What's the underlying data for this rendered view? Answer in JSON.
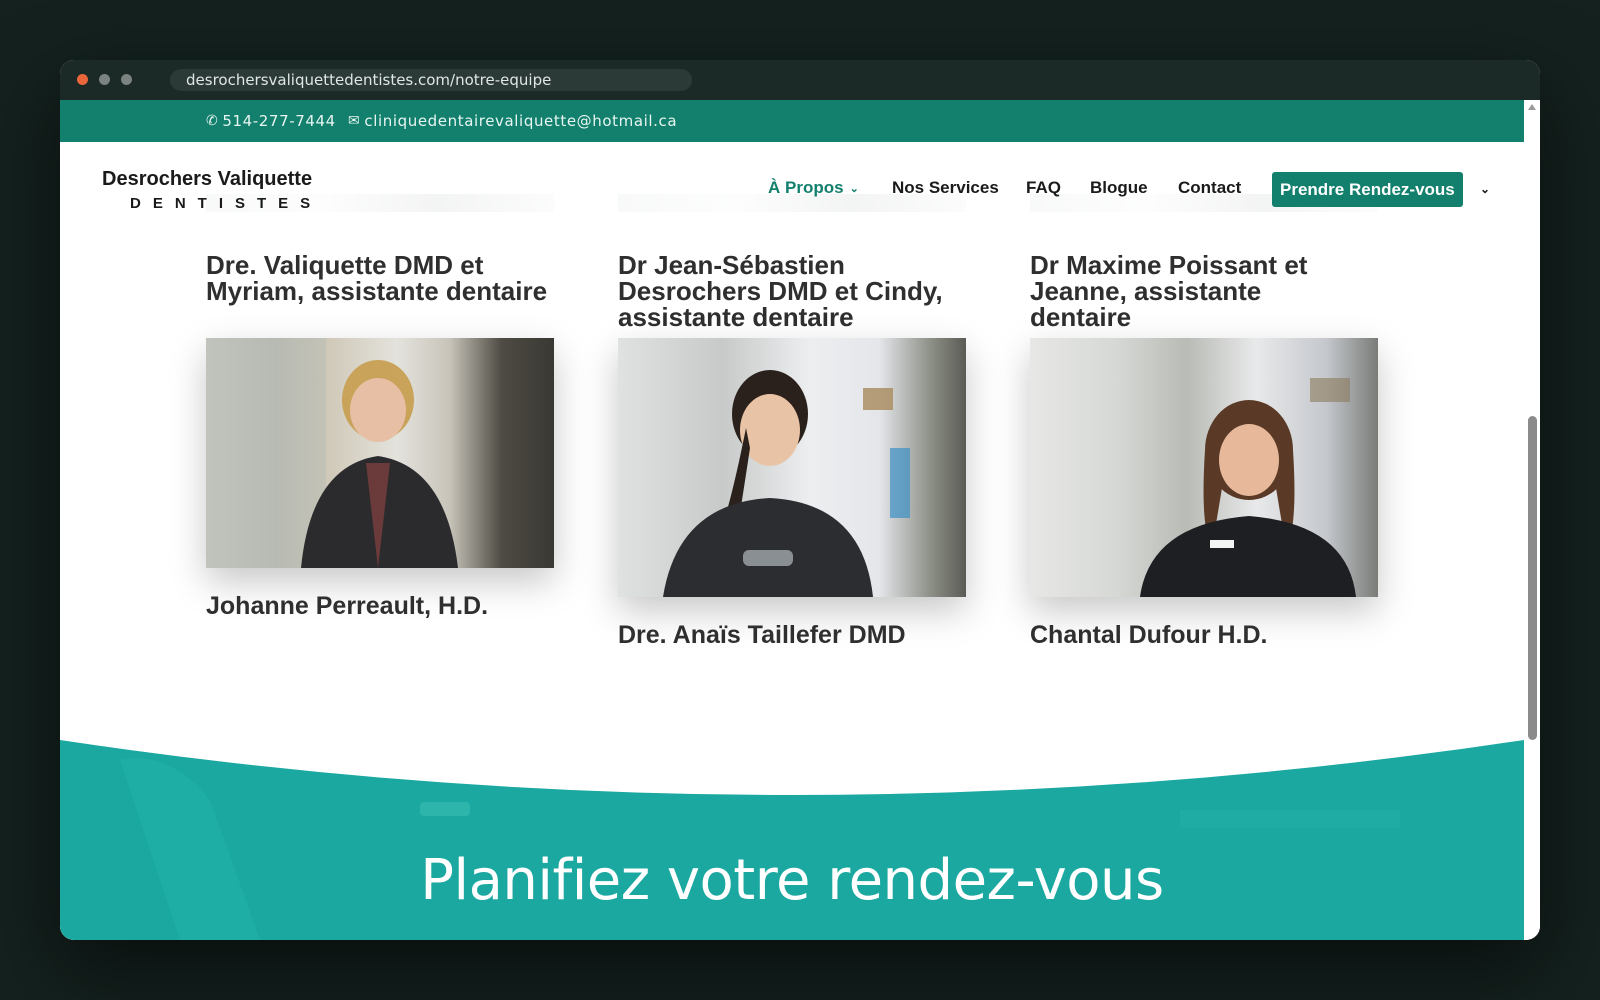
{
  "browser": {
    "url": "desrochersvaliquettedentistes.com/notre-equipe"
  },
  "topbar": {
    "phone": "514-277-7444",
    "email": "cliniquedentairevaliquette@hotmail.ca",
    "phone_icon": "phone-icon",
    "email_icon": "envelope-icon"
  },
  "header": {
    "logo_name": "Desrochers Valiquette",
    "logo_sub": "DENTISTES",
    "nav": {
      "apropos": "À Propos",
      "services": "Nos Services",
      "faq": "FAQ",
      "blogue": "Blogue",
      "contact": "Contact"
    },
    "cta": "Prendre Rendez-vous"
  },
  "previous_row": {
    "col1_line1": "Dre. Valiquette DMD et",
    "col1_line2": "Myriam, assistante dentaire",
    "col2_line1": "Dr Jean-Sébastien",
    "col2_line2": "Desrochers DMD et Cindy,",
    "col2_line3": "assistante dentaire",
    "col3_line1": "Dr Maxime Poissant et",
    "col3_line2": "Jeanne, assistante",
    "col3_line3": "dentaire"
  },
  "team": [
    {
      "name": "Johanne Perreault, H.D."
    },
    {
      "name": "Dre. Anaïs Taillefer DMD"
    },
    {
      "name": "Chantal Dufour H.D."
    }
  ],
  "footer": {
    "cta_heading": "Planifiez votre rendez-vous"
  },
  "colors": {
    "brand_green": "#13806d",
    "teal_band": "#1aa8a0",
    "text_dark": "#2f2f2f"
  }
}
